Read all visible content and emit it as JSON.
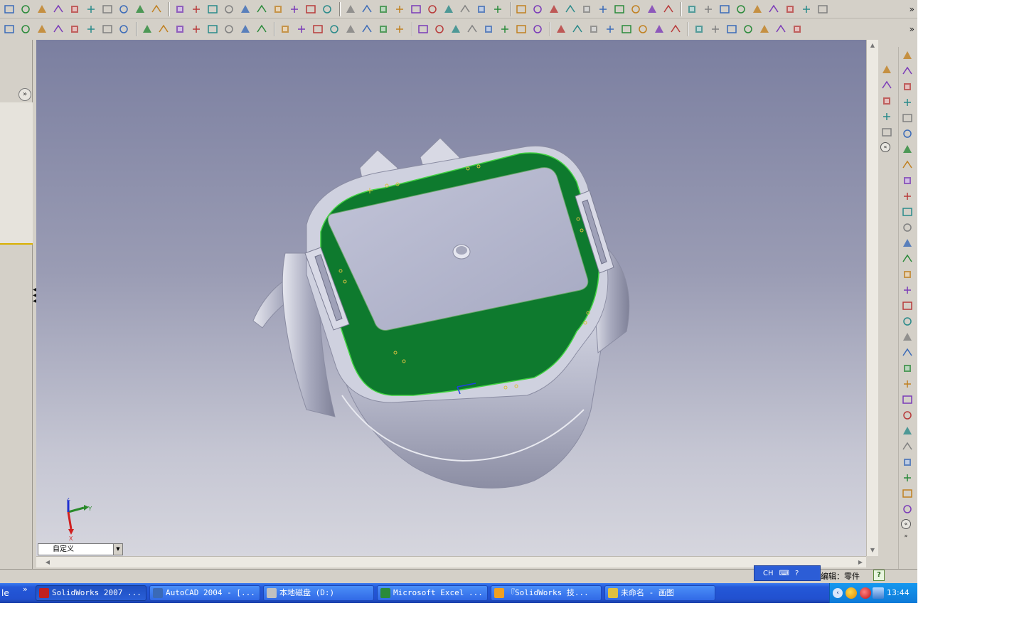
{
  "colors": {
    "app_chrome": "#d4d0c8",
    "face_highlight": "#0e7a2e",
    "face_edge": "#44d444",
    "model_surface": "#c4c6d6",
    "taskbar_blue": "#2458d8",
    "tray_blue": "#0e7ad8"
  },
  "toolbar_1": {
    "icons": [
      "new-icon",
      "open-icon",
      "save-icon",
      "print-icon",
      "preview-icon",
      "3d-icon",
      "cut-icon",
      "copy-icon",
      "paste-icon",
      "delete-icon",
      "undo-icon",
      "redo-icon",
      "traffic-light-icon",
      "tree-icon",
      "properties-icon",
      "grid-icon",
      "list-icon",
      "camera-icon",
      "brick-icon",
      "window-icon",
      "select-icon",
      "select-filter-icon",
      "globe-icon",
      "fit-icon",
      "tile-icon",
      "split-icon",
      "frame-icon",
      "help-icon",
      "sketch-icon",
      "sketch-edit-icon",
      "sketch-tools-icon",
      "zoom-fit-icon",
      "zoom-area-icon",
      "zoom-in-icon",
      "zoom-out-icon",
      "rotate-icon",
      "rotate-view-icon",
      "roll-icon",
      "pan-icon",
      "view-front-icon",
      "view-back-icon",
      "view-left-icon",
      "view-iso-icon",
      "view-shaded-icon",
      "section-icon",
      "display-icon",
      "cube-icon",
      "lock-icon",
      "color-icon"
    ],
    "more": "»"
  },
  "toolbar_2": {
    "icons": [
      "dimension-icon",
      "trim-icon",
      "offset-icon",
      "mirror-icon",
      "fix-icon",
      "relation-icon",
      "angle-icon",
      "equal-icon",
      "extrude-icon",
      "revolve-icon",
      "sweep-icon",
      "loft-icon",
      "shell-icon",
      "rib-icon",
      "fillet-icon",
      "chamfer-icon",
      "draft-icon",
      "hole-icon",
      "pattern-icon",
      "mirror-feature-icon",
      "dome-icon",
      "flex-icon",
      "wrap-icon",
      "split-line-icon",
      "curve-icon",
      "helix-icon",
      "surface-icon",
      "boss-icon",
      "cut-extrude-icon",
      "cut-revolve-icon",
      "plane-icon",
      "axis-icon",
      "point-icon",
      "coordinate-icon",
      "reference-icon",
      "sheet-metal-icon",
      "weldment-icon",
      "mold-icon",
      "routing-icon",
      "design-table-icon",
      "library-icon",
      "sensor-icon",
      "measure-icon",
      "mass-icon",
      "section-view-icon",
      "check-icon",
      "equation-icon"
    ],
    "more": "»"
  },
  "viewport": {
    "view_combo": "自定义",
    "triad": {
      "x": "X",
      "y": "Y",
      "z": "Z"
    }
  },
  "left_panel": {
    "expand": "»"
  },
  "right_toolbar_a": {
    "icons": [
      "home-view-icon",
      "standard-views-icon",
      "zoom-select-icon",
      "magnifier-icon",
      "render-icon"
    ],
    "collapse": "«"
  },
  "right_toolbar_b": {
    "icons": [
      "pointer-icon",
      "grid-icon",
      "sketch-icon",
      "smart-dim-icon",
      "hatch-icon",
      "line-icon",
      "rectangle-icon",
      "polygon-icon",
      "circle-icon",
      "circle-2-icon",
      "circle-3-icon",
      "arc-icon",
      "tangent-arc-icon",
      "three-point-arc-icon",
      "ellipse-icon",
      "partial-ellipse-icon",
      "parabola-icon",
      "spline-icon",
      "spline-2-icon",
      "point-icon",
      "centerline-icon",
      "convert-icon",
      "text-icon",
      "block-icon",
      "fillet-sketch-icon",
      "chamfer-sketch-icon",
      "offset-sketch-icon",
      "copy-sketch-icon",
      "fix-sketch-icon",
      "repair-icon"
    ],
    "collapse": "«",
    "more": "»"
  },
  "status_bar": {
    "ime_lang": "CH",
    "ime_keyboard": "⌨",
    "ime_help": "?",
    "mode_text": "编辑：零件",
    "help": "?"
  },
  "taskbar": {
    "start": "le",
    "more": "»",
    "tasks": [
      {
        "label": "SolidWorks 2007 ...",
        "icon": "solidworks-icon",
        "active": true
      },
      {
        "label": "AutoCAD 2004 - [...",
        "icon": "autocad-icon",
        "active": false
      },
      {
        "label": "本地磁盘 (D:)",
        "icon": "drive-icon",
        "active": false
      },
      {
        "label": "Microsoft Excel ...",
        "icon": "excel-icon",
        "active": false
      },
      {
        "label": "『SolidWorks 技...",
        "icon": "browser-icon",
        "active": false
      },
      {
        "label": "未命名 - 画图",
        "icon": "paint-icon",
        "active": false
      }
    ],
    "tray": {
      "chevron": "‹",
      "icons": [
        "qq-icon",
        "antivirus-icon",
        "network-icon"
      ],
      "clock": "13:44"
    }
  }
}
